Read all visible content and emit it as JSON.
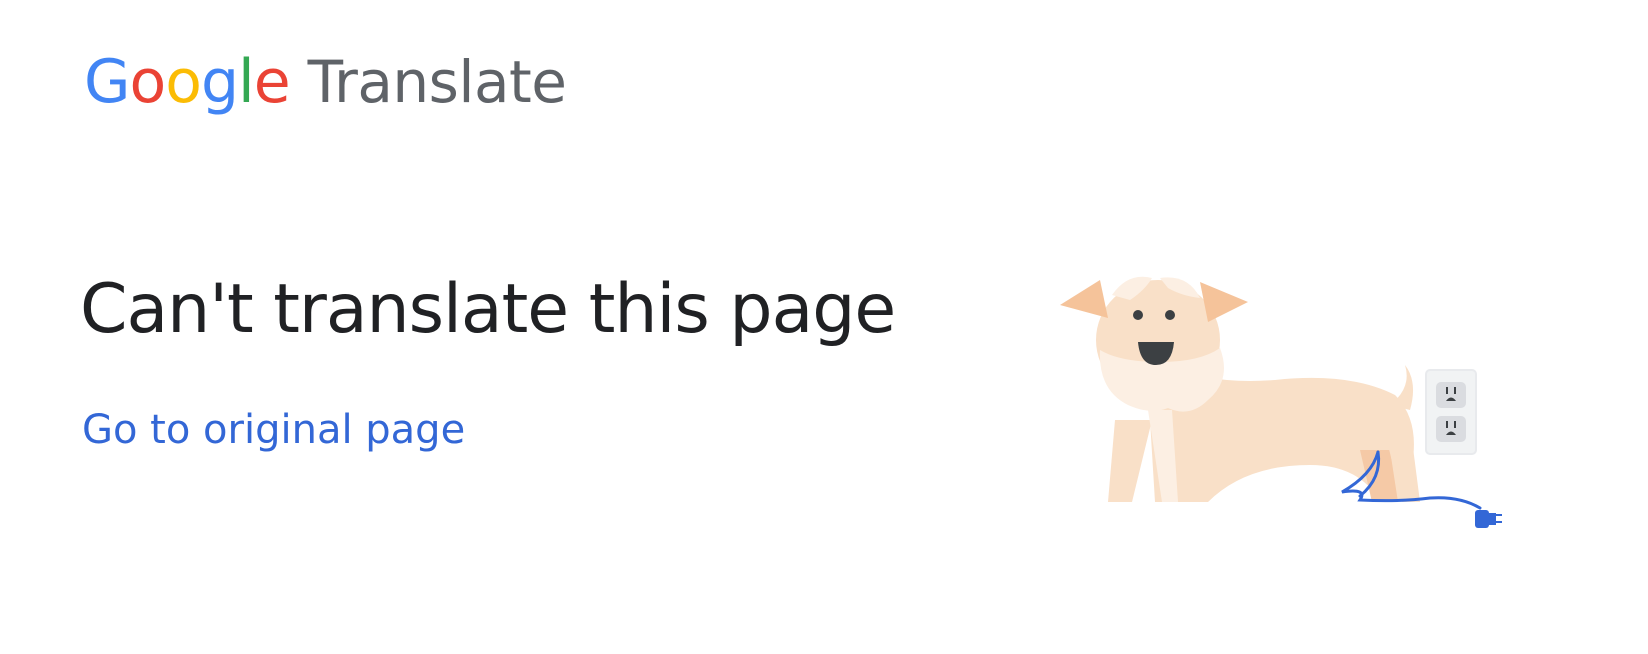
{
  "header": {
    "logo_letters": [
      {
        "char": "G",
        "color": "#4285f4"
      },
      {
        "char": "o",
        "color": "#ea4335"
      },
      {
        "char": "o",
        "color": "#fbbc05"
      },
      {
        "char": "g",
        "color": "#4285f4"
      },
      {
        "char": "l",
        "color": "#34a853"
      },
      {
        "char": "e",
        "color": "#ea4335"
      }
    ],
    "product_name": "Translate"
  },
  "main": {
    "title": "Can't translate this page",
    "original_page_link": "Go to original page"
  },
  "illustration": {
    "subject_icon": "unplugged-dog-icon",
    "outlet_icon": "wall-outlet-icon",
    "plug_icon": "plug-icon",
    "colors": {
      "dog_body": "#f9e0c8",
      "dog_light": "#fcefe3",
      "dog_ears": "#f5c39a",
      "dog_features": "#3c4043",
      "cord": "#3367d6",
      "outlet": "#f1f3f4"
    }
  },
  "colors": {
    "link": "#3367d6",
    "title": "#202124",
    "product_name": "#5f6368"
  }
}
